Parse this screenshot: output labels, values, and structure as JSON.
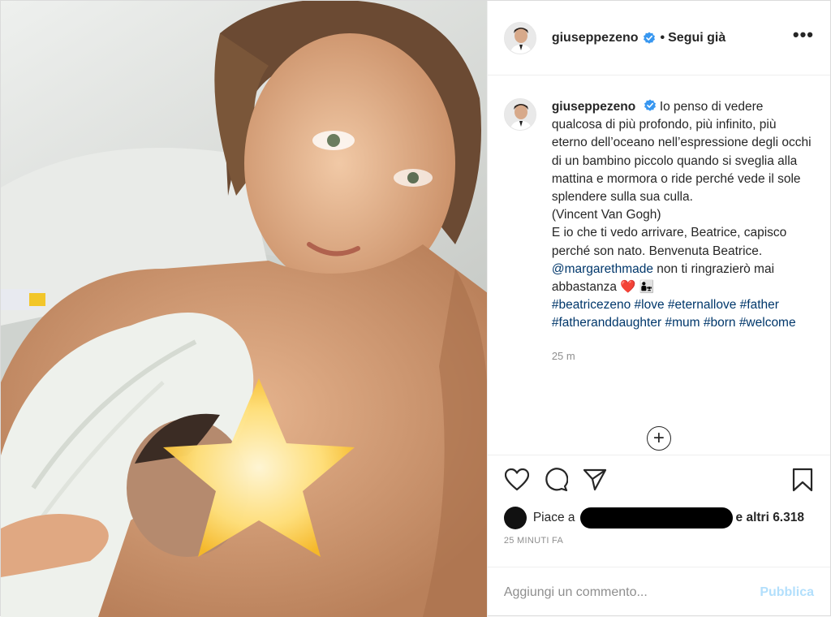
{
  "post": {
    "photo_alt": "",
    "author": {
      "username": "giuseppezeno",
      "verified": true,
      "follow_label": "Segui già",
      "more_label": "•••"
    },
    "caption": {
      "username": "giuseppezeno",
      "line1": "Io penso di vedere qualcosa di più profondo, più infinito, più eterno dell’oceano nell’espressione degli occhi di un bambino piccolo quando si sveglia alla mattina e mormora o ride perché vede il sole splendere sulla sua culla.",
      "line2": "(Vincent Van Gogh)",
      "line3": "E io che ti vedo arrivare, Beatrice, capisco perché son nato. Benvenuta Beatrice.",
      "mention": "@margarethmade",
      "line4": "non ti ringrazierò mai abbastanza",
      "heart": "❤️",
      "family": "👨‍👧",
      "hashtags": [
        "#beatricezeno",
        "#love",
        "#eternallove",
        "#father",
        "#fatheranddaughter",
        "#mum",
        "#born",
        "#welcome"
      ],
      "time": "25 m"
    },
    "load_more": "+",
    "actions": {
      "like_icon": "heart-outline-icon",
      "comment_icon": "speech-bubble-icon",
      "share_icon": "paper-plane-icon",
      "save_icon": "bookmark-icon"
    },
    "likes": {
      "prefix": "Piace a",
      "suffix": "e altri 6.318"
    },
    "date": "25 MINUTI FA",
    "comment_input": {
      "placeholder": "Aggiungi un commento...",
      "publish_label": "Pubblica"
    }
  },
  "colors": {
    "link": "#00376b",
    "verified": "#3897f0",
    "publish_disabled": "#b2dffc",
    "muted": "#8e8e8e"
  }
}
